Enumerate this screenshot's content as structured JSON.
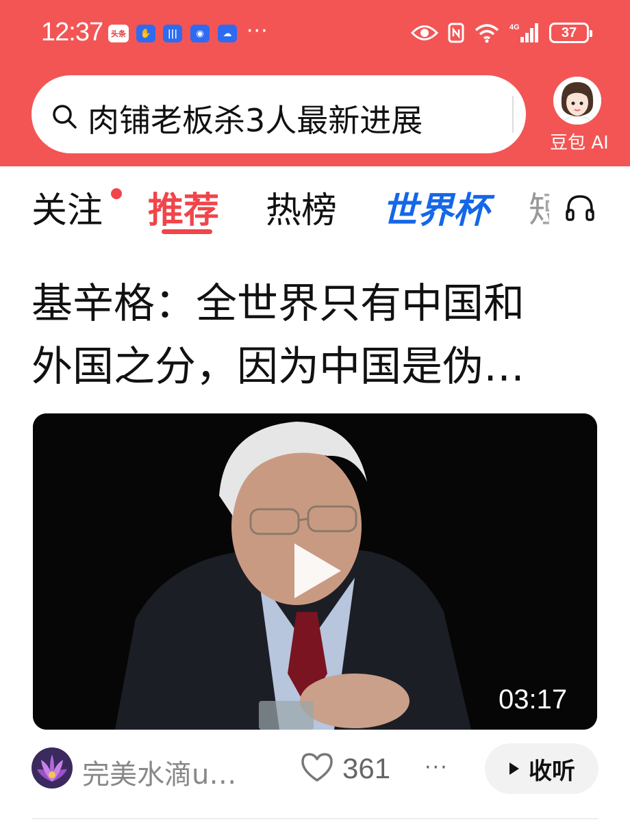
{
  "status_bar": {
    "time": "12:37",
    "notif_badge": "头条",
    "more": "···",
    "network": "4G",
    "battery": "37"
  },
  "search": {
    "query": "肉铺老板杀3人最新进展"
  },
  "assistant": {
    "label": "豆包 AI"
  },
  "tabs": [
    {
      "label": "关注",
      "has_dot": true
    },
    {
      "label": "推荐",
      "active": true
    },
    {
      "label": "热榜"
    },
    {
      "label": "世界杯"
    },
    {
      "label": "短"
    }
  ],
  "article": {
    "title_line1": "基辛格：全世界只有中国和",
    "title_line2": "外国之分，因为中国是伪…",
    "video_duration": "03:17",
    "author": "完美水滴u…",
    "likes": "361",
    "more": "···",
    "listen_label": "收听"
  },
  "colors": {
    "header_red": "#f35555",
    "active_tab": "#f0454a",
    "worldcup_blue": "#1467e8"
  }
}
